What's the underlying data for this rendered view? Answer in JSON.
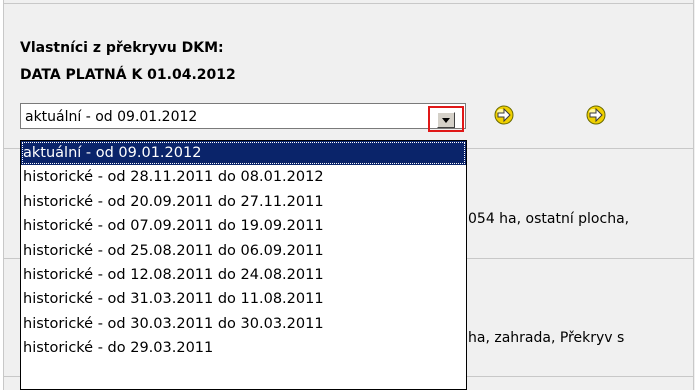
{
  "section": {
    "title": "Vlastníci z překryvu DKM:",
    "subtitle": "DATA PLATNÁ K 01.04.2012"
  },
  "version_select": {
    "value": "aktuální - od 09.01.2012",
    "options": [
      "aktuální - od 09.01.2012",
      "historické - od 28.11.2011 do 08.01.2012",
      "historické - od 20.09.2011 do 27.11.2011",
      "historické - od 07.09.2011 do 19.09.2011",
      "historické - od 25.08.2011 do 06.09.2011",
      "historické - od 12.08.2011 do 24.08.2011",
      "historické - od 31.03.2011 do 11.08.2011",
      "historické - od 30.03.2011 do 30.03.2011",
      "historické - do 29.03.2011"
    ]
  },
  "background": {
    "row1_text": "054 ha, ostatní plocha,",
    "row2_text": "ha, zahrada, Překryv s"
  },
  "icons": {
    "nav_prev": "go-arrow-icon",
    "nav_next": "go-arrow-icon",
    "dropdown": "chevron-down-icon"
  },
  "colors": {
    "selection": "#0a246a",
    "highlight_border": "#e01818",
    "icon_fill": "#f0d000"
  }
}
